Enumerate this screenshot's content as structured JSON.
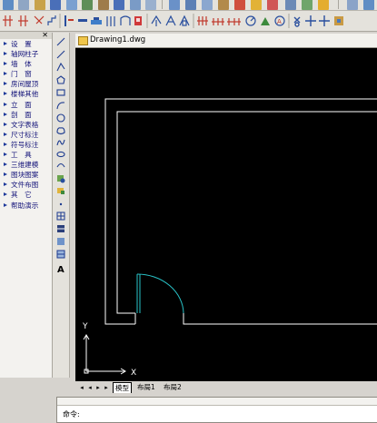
{
  "palette": {
    "items": [
      "设　置",
      "轴网柱子",
      "墙　体",
      "门　窗",
      "房间屋顶",
      "楼梯其他",
      "立　面",
      "剖　面",
      "文字表格",
      "尺寸标注",
      "符号标注",
      "工　具",
      "三维建模",
      "图块图案",
      "文件布图",
      "其　它",
      "帮助演示"
    ]
  },
  "drawing": {
    "title": "Drawing1.dwg",
    "ucs_y": "Y",
    "ucs_x": "X"
  },
  "tabs": [
    "模型",
    "布局1",
    "布局2"
  ],
  "command": {
    "prompt": "命令:"
  },
  "colors": {
    "canvas": "#000000",
    "wall": "#ffffff",
    "door_arc": "#29c3c8",
    "palette_text": "#14147a"
  }
}
